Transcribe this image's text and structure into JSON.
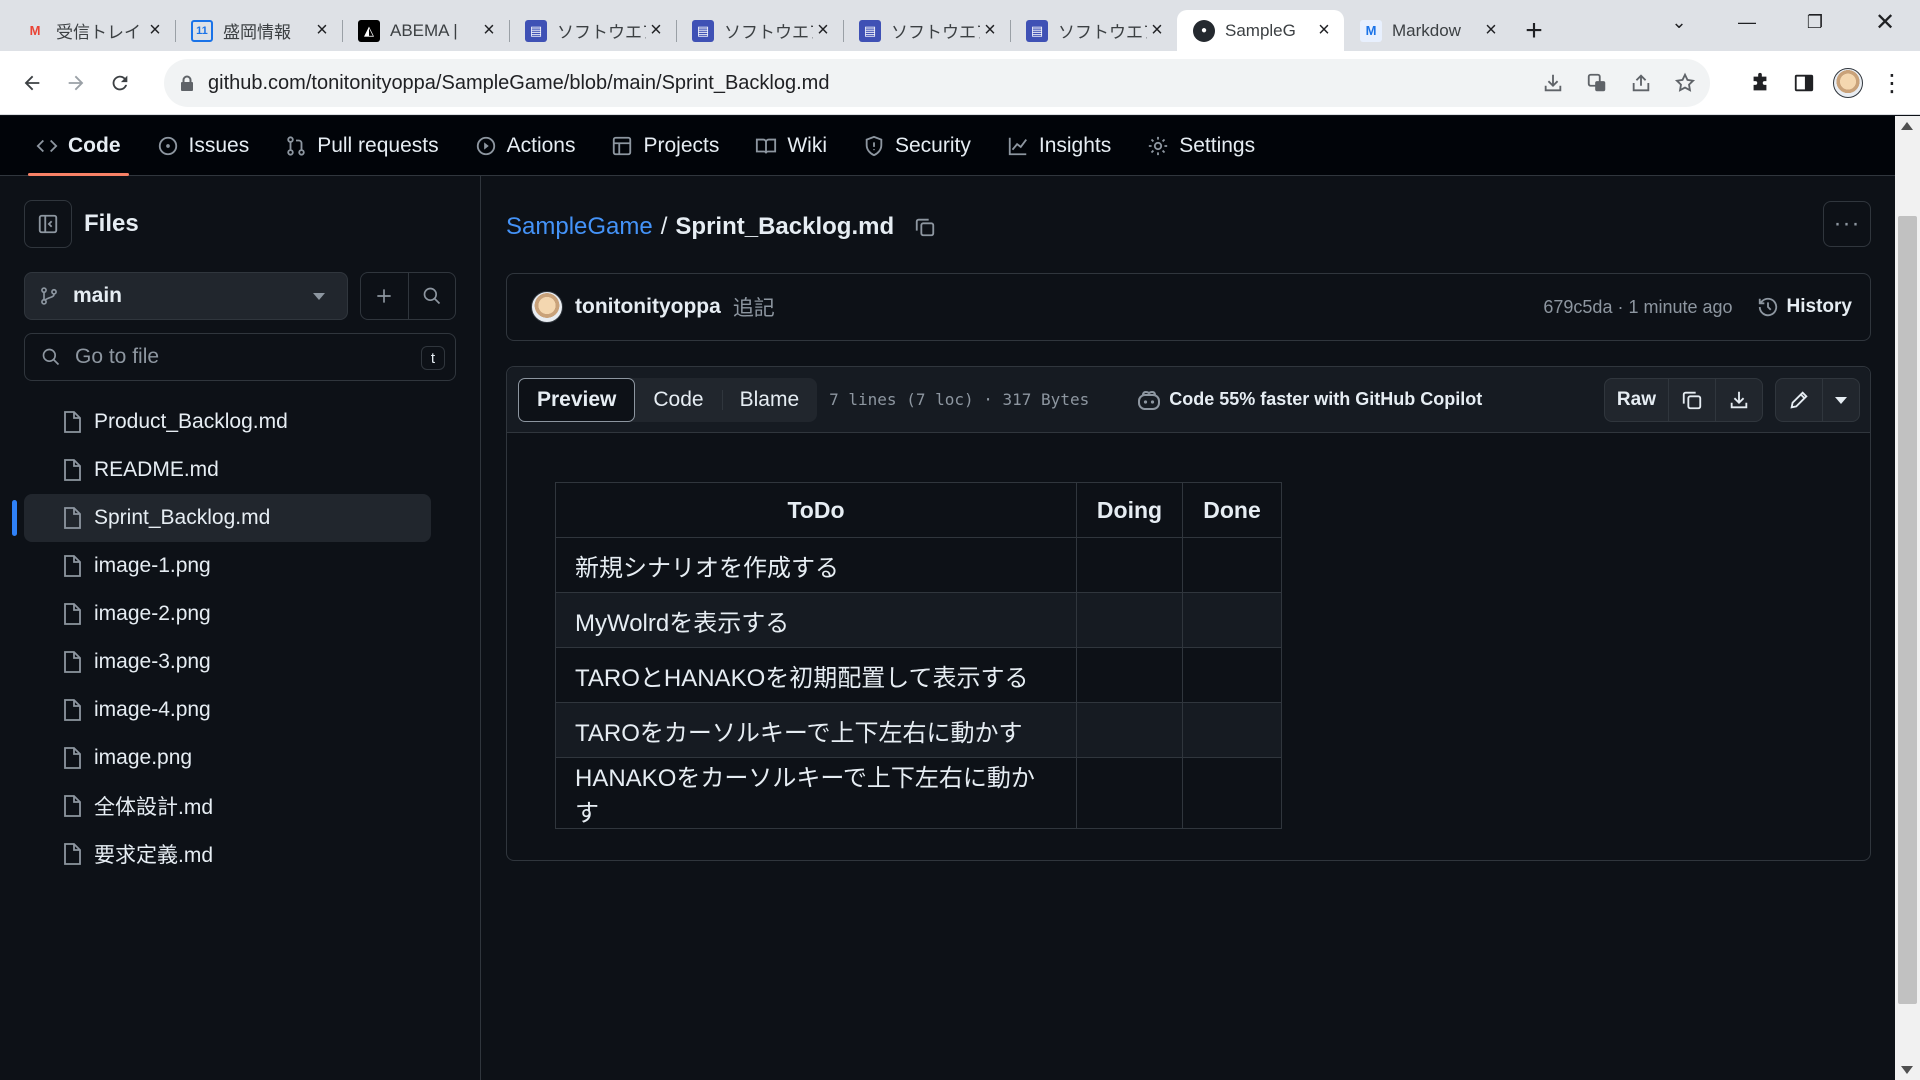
{
  "browser": {
    "tabs": [
      {
        "title": "受信トレイ",
        "icon": "gmail-icon",
        "color": "#ea4335",
        "glyph": "M"
      },
      {
        "title": "盛岡情報",
        "icon": "calendar-icon",
        "color": "#1a73e8",
        "glyph": "11"
      },
      {
        "title": "ABEMA |",
        "icon": "abema-icon",
        "color": "#000000",
        "glyph": "◭"
      },
      {
        "title": "ソフトウエア",
        "icon": "forms-icon",
        "color": "#3f51b5",
        "glyph": "▤"
      },
      {
        "title": "ソフトウエア",
        "icon": "forms-icon",
        "color": "#3f51b5",
        "glyph": "▤"
      },
      {
        "title": "ソフトウエア",
        "icon": "forms-icon",
        "color": "#3f51b5",
        "glyph": "▤"
      },
      {
        "title": "ソフトウエア",
        "icon": "forms-icon",
        "color": "#3f51b5",
        "glyph": "▤"
      },
      {
        "title": "SampleG",
        "icon": "github-icon",
        "color": "#24292f",
        "glyph": "●",
        "active": true
      },
      {
        "title": "Markdow",
        "icon": "markdown-icon",
        "color": "#1a73e8",
        "glyph": "M"
      }
    ],
    "url": "github.com/tonitonityoppa/SampleGame/blob/main/Sprint_Backlog.md"
  },
  "repo_nav": {
    "items": [
      {
        "label": "Code",
        "icon": "code-icon"
      },
      {
        "label": "Issues",
        "icon": "issue-icon"
      },
      {
        "label": "Pull requests",
        "icon": "pull-request-icon"
      },
      {
        "label": "Actions",
        "icon": "actions-icon"
      },
      {
        "label": "Projects",
        "icon": "projects-icon"
      },
      {
        "label": "Wiki",
        "icon": "book-icon"
      },
      {
        "label": "Security",
        "icon": "shield-icon"
      },
      {
        "label": "Insights",
        "icon": "graph-icon"
      },
      {
        "label": "Settings",
        "icon": "gear-icon"
      }
    ]
  },
  "sidebar": {
    "title": "Files",
    "branch": "main",
    "goto_placeholder": "Go to file",
    "goto_shortcut": "t",
    "files": [
      {
        "name": "Product_Backlog.md"
      },
      {
        "name": "README.md"
      },
      {
        "name": "Sprint_Backlog.md"
      },
      {
        "name": "image-1.png"
      },
      {
        "name": "image-2.png"
      },
      {
        "name": "image-3.png"
      },
      {
        "name": "image-4.png"
      },
      {
        "name": "image.png"
      },
      {
        "name": "全体設計.md"
      },
      {
        "name": "要求定義.md"
      }
    ]
  },
  "breadcrumb": {
    "repo": "SampleGame",
    "separator": "/",
    "file": "Sprint_Backlog.md"
  },
  "commit": {
    "author": "tonitonityoppa",
    "message": "追記",
    "meta": "679c5da · 1 minute ago",
    "history_label": "History"
  },
  "file_header": {
    "tabs": [
      "Preview",
      "Code",
      "Blame"
    ],
    "info": "7 lines (7 loc) · 317 Bytes",
    "copilot": "Code 55% faster with GitHub Copilot",
    "raw_label": "Raw"
  },
  "table": {
    "headers": [
      "ToDo",
      "Doing",
      "Done"
    ],
    "rows": [
      [
        "新規シナリオを作成する",
        "",
        ""
      ],
      [
        "MyWolrdを表示する",
        "",
        ""
      ],
      [
        "TAROとHANAKOを初期配置して表示する",
        "",
        ""
      ],
      [
        "TAROをカーソルキーで上下左右に動かす",
        "",
        ""
      ],
      [
        "HANAKOをカーソルキーで上下左右に動かす",
        "",
        ""
      ]
    ]
  },
  "colors": {
    "accent": "#f78166",
    "link": "#4493f8",
    "bg": "#0d1117"
  }
}
